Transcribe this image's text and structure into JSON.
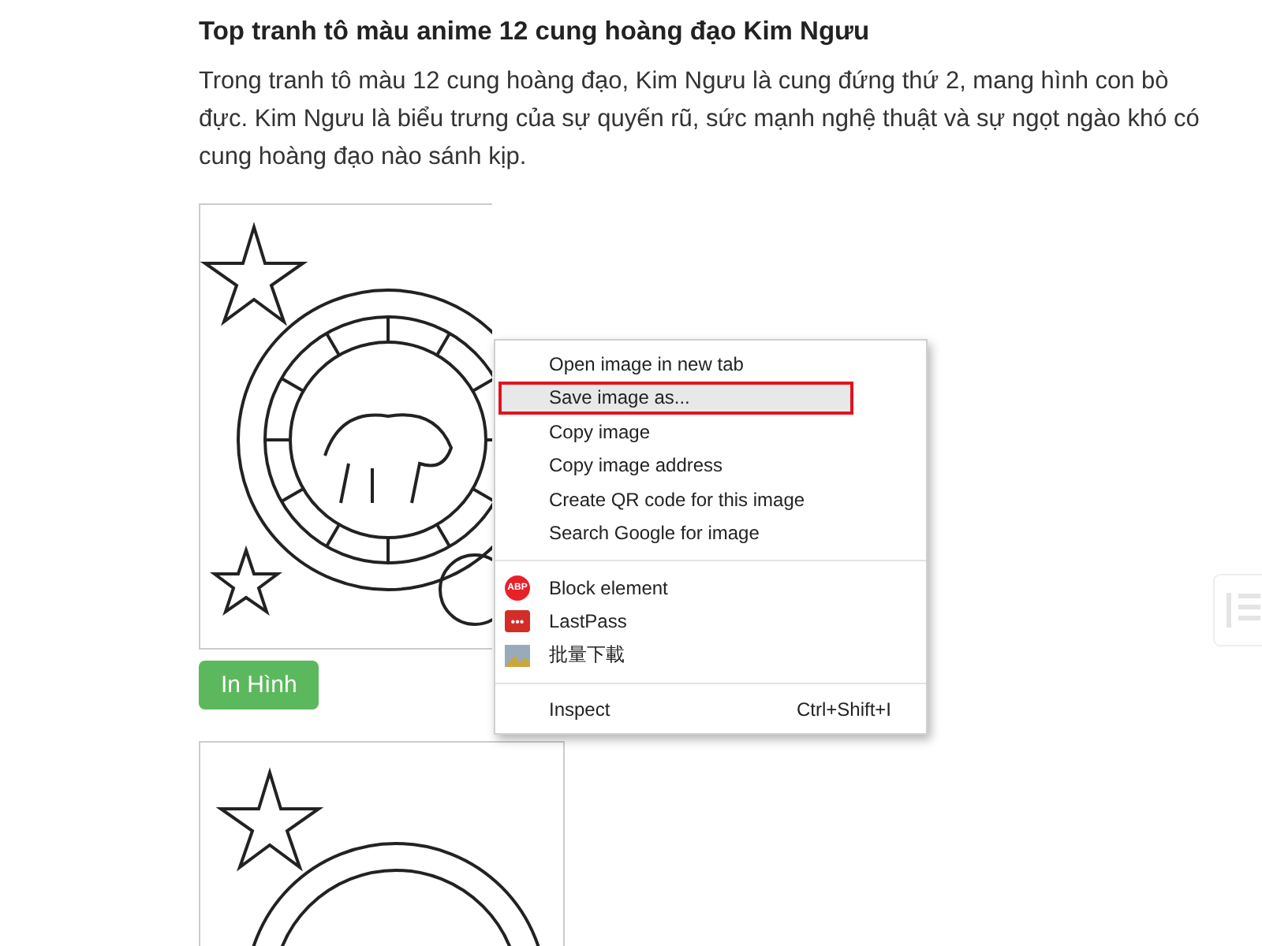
{
  "article": {
    "heading": "Top tranh tô màu anime 12 cung hoàng đạo Kim Ngưu",
    "paragraph": "Trong tranh tô màu 12 cung hoàng đạo, Kim Ngưu là cung đứng thứ 2, mang hình con bò đực. Kim Ngưu là biểu trưng của sự quyến rũ, sức mạnh nghệ thuật và sự ngọt ngào khó có cung hoàng đạo nào sánh kịp.",
    "print_button": "In Hình"
  },
  "context_menu": {
    "groups": [
      [
        {
          "label": "Open image in new tab",
          "selected": false
        },
        {
          "label": "Save image as...",
          "selected": true
        },
        {
          "label": "Copy image",
          "selected": false
        },
        {
          "label": "Copy image address",
          "selected": false
        },
        {
          "label": "Create QR code for this image",
          "selected": false
        },
        {
          "label": "Search Google for image",
          "selected": false
        }
      ],
      [
        {
          "label": "Block element",
          "selected": false,
          "kind": "abp",
          "icon_text": "ABP"
        },
        {
          "label": "LastPass",
          "selected": false,
          "kind": "lastpass",
          "icon_text": "•••"
        },
        {
          "label": "批量下載",
          "selected": false,
          "kind": "picture"
        }
      ],
      [
        {
          "label": "Inspect",
          "selected": false,
          "shortcut": "Ctrl+Shift+I"
        }
      ]
    ]
  }
}
